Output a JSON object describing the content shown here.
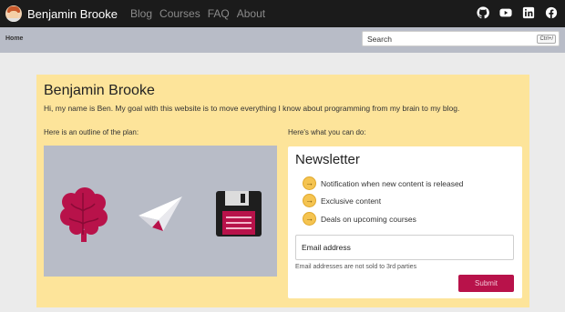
{
  "header": {
    "brand": "Benjamin Brooke",
    "nav": [
      "Blog",
      "Courses",
      "FAQ",
      "About"
    ],
    "social_icons": [
      "github-icon",
      "youtube-icon",
      "linkedin-icon",
      "facebook-icon"
    ]
  },
  "subbar": {
    "breadcrumb": "Home",
    "search_placeholder": "Search",
    "search_shortcut": "Ctrl+/"
  },
  "hero": {
    "title": "Benjamin Brooke",
    "intro": "Hi, my name is Ben. My goal with this website is to move everything I know about programming from my brain to my blog.",
    "outline_label": "Here is an outline of the plan:",
    "todo_label": "Here's what you can do:",
    "plan_icons": [
      "brain-icon",
      "paper-plane-icon",
      "floppy-disk-icon"
    ]
  },
  "newsletter": {
    "title": "Newsletter",
    "benefits": [
      "Notification when new content is released",
      "Exclusive content",
      "Deals on upcoming courses"
    ],
    "email_placeholder": "Email address",
    "note": "Email addresses are not sold to 3rd parties",
    "submit": "Submit"
  },
  "colors": {
    "topbar": "#1b1b1b",
    "subbar": "#b8bcc7",
    "hero": "#fde49a",
    "accent": "#b8124a"
  }
}
